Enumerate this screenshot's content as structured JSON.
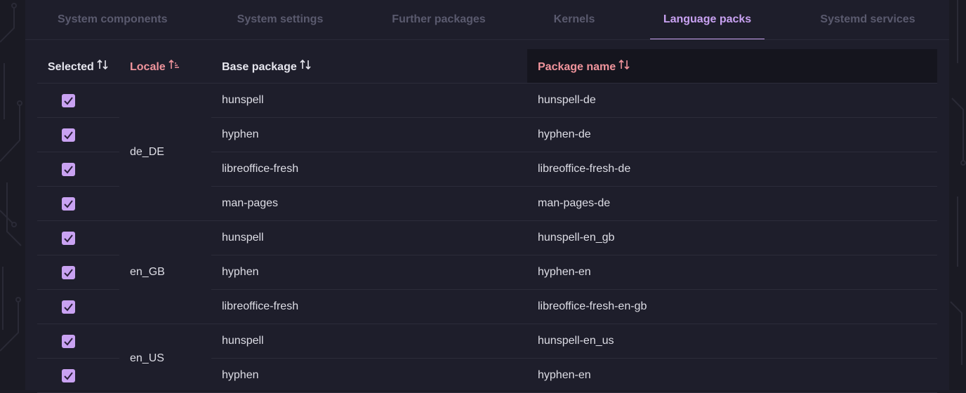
{
  "tabs": [
    {
      "label": "System components",
      "active": false
    },
    {
      "label": "System settings",
      "active": false
    },
    {
      "label": "Further packages",
      "active": false
    },
    {
      "label": "Kernels",
      "active": false
    },
    {
      "label": "Language packs",
      "active": true
    },
    {
      "label": "Systemd services",
      "active": false
    }
  ],
  "table": {
    "headers": {
      "selected": "Selected",
      "locale": "Locale",
      "base_package": "Base package",
      "package_name": "Package name"
    },
    "sort_icons": {
      "selected": "sort-both-icon",
      "locale": "sort-ascending-icon",
      "base_package": "sort-both-icon",
      "package_name": "sort-both-icon"
    },
    "groups": [
      {
        "locale": "de_DE",
        "rows": [
          {
            "selected": true,
            "base": "hunspell",
            "package": "hunspell-de"
          },
          {
            "selected": true,
            "base": "hyphen",
            "package": "hyphen-de"
          },
          {
            "selected": true,
            "base": "libreoffice-fresh",
            "package": "libreoffice-fresh-de"
          },
          {
            "selected": true,
            "base": "man-pages",
            "package": "man-pages-de"
          }
        ]
      },
      {
        "locale": "en_GB",
        "rows": [
          {
            "selected": true,
            "base": "hunspell",
            "package": "hunspell-en_gb"
          },
          {
            "selected": true,
            "base": "hyphen",
            "package": "hyphen-en"
          },
          {
            "selected": true,
            "base": "libreoffice-fresh",
            "package": "libreoffice-fresh-en-gb"
          }
        ]
      },
      {
        "locale": "en_US",
        "rows": [
          {
            "selected": true,
            "base": "hunspell",
            "package": "hunspell-en_us"
          },
          {
            "selected": true,
            "base": "hyphen",
            "package": "hyphen-en"
          }
        ]
      }
    ]
  },
  "colors": {
    "accent": "#c9a2f2",
    "sorted_header": "#f0949c",
    "background": "#1e1e2b"
  }
}
